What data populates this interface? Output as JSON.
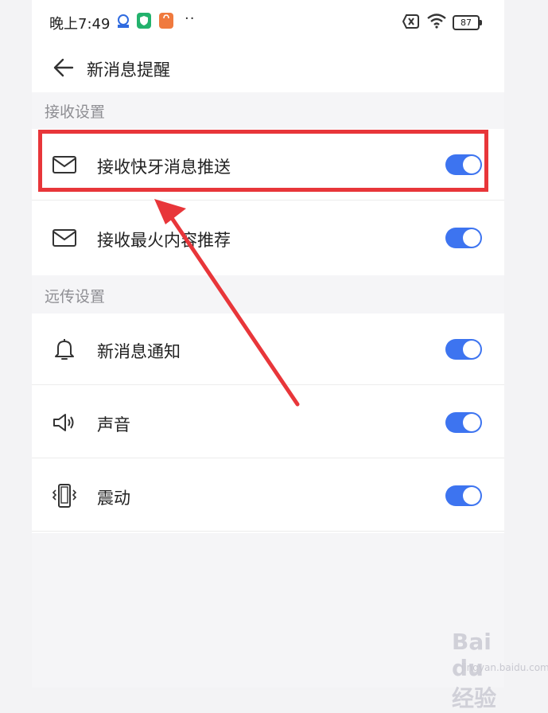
{
  "statusbar": {
    "time": "晚上7:49",
    "battery": "87",
    "app_icons": [
      "baidu-icon",
      "shield-app-icon",
      "shopping-bag-icon"
    ],
    "dots": "··"
  },
  "header": {
    "title": "新消息提醒"
  },
  "sections": [
    {
      "label": "接收设置",
      "items": [
        {
          "label": "接收快牙消息推送",
          "icon": "mail-icon",
          "enabled": true
        },
        {
          "label": "接收最火内容推荐",
          "icon": "mail-icon",
          "enabled": true
        }
      ]
    },
    {
      "label": "远传设置",
      "items": [
        {
          "label": "新消息通知",
          "icon": "bell-icon",
          "enabled": true
        },
        {
          "label": "声音",
          "icon": "speaker-icon",
          "enabled": true
        },
        {
          "label": "震动",
          "icon": "vibrate-icon",
          "enabled": true
        }
      ]
    }
  ],
  "colors": {
    "toggle_on": "#3d74f0",
    "highlight": "#e8363a",
    "background": "#f5f5f7"
  },
  "watermark": {
    "main": "Bai du 经验",
    "sub": "jingyan.baidu.com"
  }
}
